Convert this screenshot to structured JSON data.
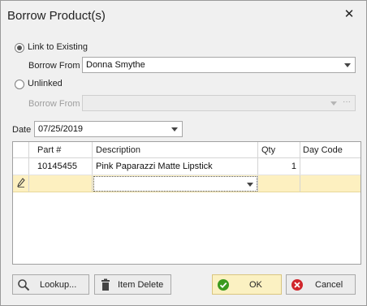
{
  "window": {
    "title": "Borrow Product(s)",
    "close_glyph": "✕"
  },
  "link_options": {
    "link_to_existing": {
      "label": "Link to Existing",
      "checked": true
    },
    "borrow_from_label": "Borrow From",
    "borrow_from_value": "Donna Smythe",
    "unlinked": {
      "label": "Unlinked",
      "checked": false
    },
    "unlinked_borrow_from_label": "Borrow From",
    "unlinked_borrow_from_value": "",
    "ellipsis": "···"
  },
  "date": {
    "label": "Date",
    "value": "07/25/2019"
  },
  "grid": {
    "columns": [
      "Part #",
      "Description",
      "Qty",
      "Day Code"
    ],
    "rows": [
      {
        "part": "10145455",
        "description": "Pink Paparazzi Matte Lipstick",
        "qty": "1",
        "day_code": ""
      }
    ],
    "new_row_icon": "pencil-icon"
  },
  "buttons": {
    "lookup": "Lookup...",
    "item_delete": "Item Delete",
    "ok": "OK",
    "cancel": "Cancel"
  },
  "colors": {
    "accent_new_row": "#fdf0c0",
    "ok_button": "#fbf1c2",
    "ok_icon": "#3a9a1e",
    "cancel_icon": "#d0252b"
  }
}
